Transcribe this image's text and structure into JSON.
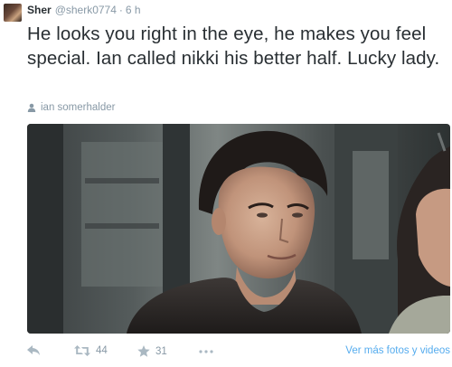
{
  "tweet": {
    "author_name": "Sher",
    "author_handle": "@sherk0774",
    "separator": "·",
    "time": "6 h",
    "text": "He looks you right in the eye, he makes you feel special. Ian called nikki his better half. Lucky lady.",
    "context_icon": "person-icon",
    "context_label": "ian somerhalder"
  },
  "actions": {
    "reply_icon": "reply-icon",
    "retweet_icon": "retweet-icon",
    "retweet_count": "44",
    "favorite_icon": "star-icon",
    "favorite_count": "31",
    "more_icon": "more-dots-icon",
    "view_more_label": "Ver más fotos y videos"
  },
  "colors": {
    "text": "#292f33",
    "muted": "#8899a6",
    "icon": "#aab8c2",
    "link": "#55acee"
  }
}
